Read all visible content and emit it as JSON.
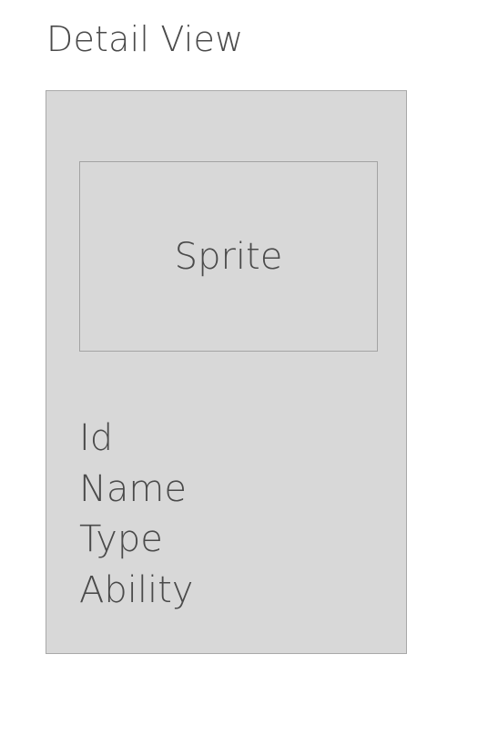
{
  "header": {
    "title": "Detail View"
  },
  "card": {
    "sprite_label": "Sprite",
    "fields": [
      "Id",
      "Name",
      "Type",
      "Ability"
    ]
  }
}
